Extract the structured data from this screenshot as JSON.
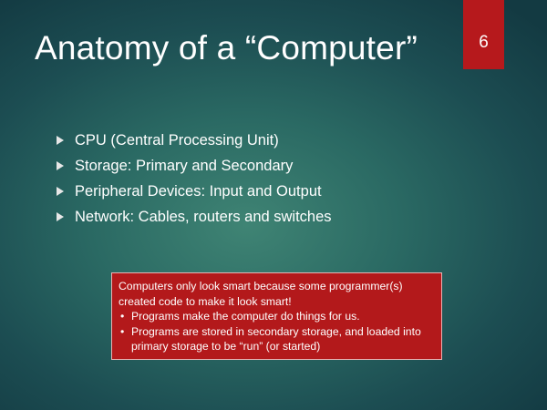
{
  "slide": {
    "title": "Anatomy of a “Computer”",
    "number": "6",
    "bullets": [
      "CPU (Central Processing Unit)",
      "Storage: Primary and Secondary",
      "Peripheral Devices: Input and Output",
      "Network: Cables, routers and switches"
    ],
    "callout": {
      "text": "Computers only look smart because some programmer(s) created code to make it look smart!",
      "items": [
        "Programs make the computer do things for us.",
        "Programs are stored in secondary storage, and loaded into primary storage to be “run”  (or started)"
      ]
    }
  },
  "colors": {
    "background_center": "#3f8474",
    "background_edge": "#133a42",
    "accent_red": "#b6191c",
    "text": "#ffffff"
  },
  "icons": {
    "bullet": "triangle-right-icon",
    "callout_bullet": "•"
  }
}
